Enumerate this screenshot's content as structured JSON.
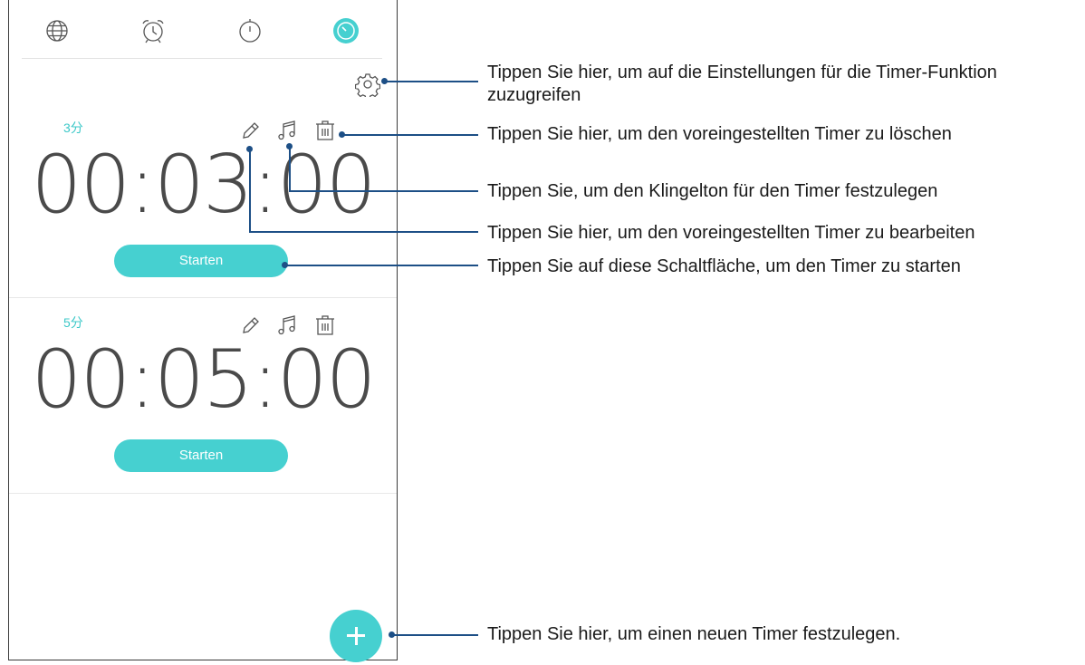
{
  "tabs": [
    {
      "name": "world-clock",
      "icon": "globe-icon"
    },
    {
      "name": "alarm",
      "icon": "alarm-clock-icon"
    },
    {
      "name": "stopwatch",
      "icon": "stopwatch-icon"
    },
    {
      "name": "timer",
      "icon": "timer-icon",
      "active": true
    }
  ],
  "colors": {
    "accent": "#46d0d0",
    "label": "#3cc8c8",
    "callout": "#1d4f86",
    "digits": "#4a4a4a"
  },
  "timers": [
    {
      "label": "3分",
      "time": "00:03:00",
      "start_label": "Starten"
    },
    {
      "label": "5分",
      "time": "00:05:00",
      "start_label": "Starten"
    }
  ],
  "callouts": {
    "settings": "Tippen Sie hier, um auf die Einstellungen für die Timer-Funktion zuzugreifen",
    "delete": "Tippen Sie hier, um den voreingestellten Timer zu löschen",
    "ringtone": "Tippen Sie, um den Klingelton für den Timer festzulegen",
    "edit": "Tippen Sie hier, um den voreingestellten Timer zu bearbeiten",
    "start": "Tippen Sie auf diese Schaltfläche, um den Timer zu starten",
    "add": "Tippen Sie hier, um einen neuen Timer festzulegen."
  }
}
